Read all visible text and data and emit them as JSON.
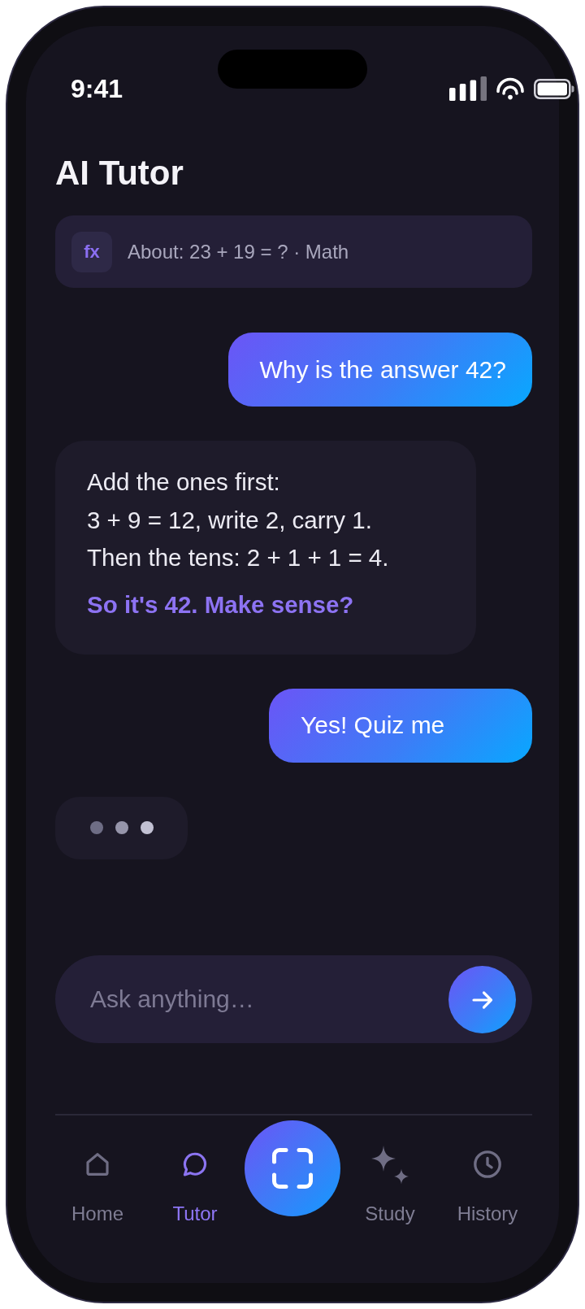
{
  "status_bar": {
    "time": "9:41"
  },
  "header": {
    "title": "AI Tutor"
  },
  "context": {
    "badge": "fx",
    "text": "About: 23 + 19 = ? · Math"
  },
  "messages": [
    {
      "kind": "user",
      "text": "Why is the answer 42?"
    },
    {
      "kind": "tutor",
      "lines": [
        {
          "kind": "plain",
          "text": "Add the ones first:"
        },
        {
          "kind": "plain",
          "text": "3 + 9 = 12, write 2, carry 1."
        },
        {
          "kind": "plain",
          "text": "Then the tens: 2 + 1 + 1 = 4."
        },
        {
          "kind": "emphasis",
          "text": "So it's 42. Make sense?"
        }
      ]
    },
    {
      "kind": "user",
      "text": "Yes! Quiz me"
    },
    {
      "kind": "typing",
      "dots": [
        {
          "color": "#6e6d85"
        },
        {
          "color": "#9695aa"
        },
        {
          "color": "#c2c1d3"
        }
      ]
    }
  ],
  "composer": {
    "placeholder": "Ask anything…"
  },
  "nav": {
    "items": [
      {
        "kind": "tab",
        "label": "Home",
        "selected": false
      },
      {
        "kind": "tab",
        "label": "Tutor",
        "selected": true
      },
      {
        "kind": "scan"
      },
      {
        "kind": "tab",
        "label": "Study",
        "selected": false
      },
      {
        "kind": "tab",
        "label": "History",
        "selected": false
      }
    ]
  }
}
